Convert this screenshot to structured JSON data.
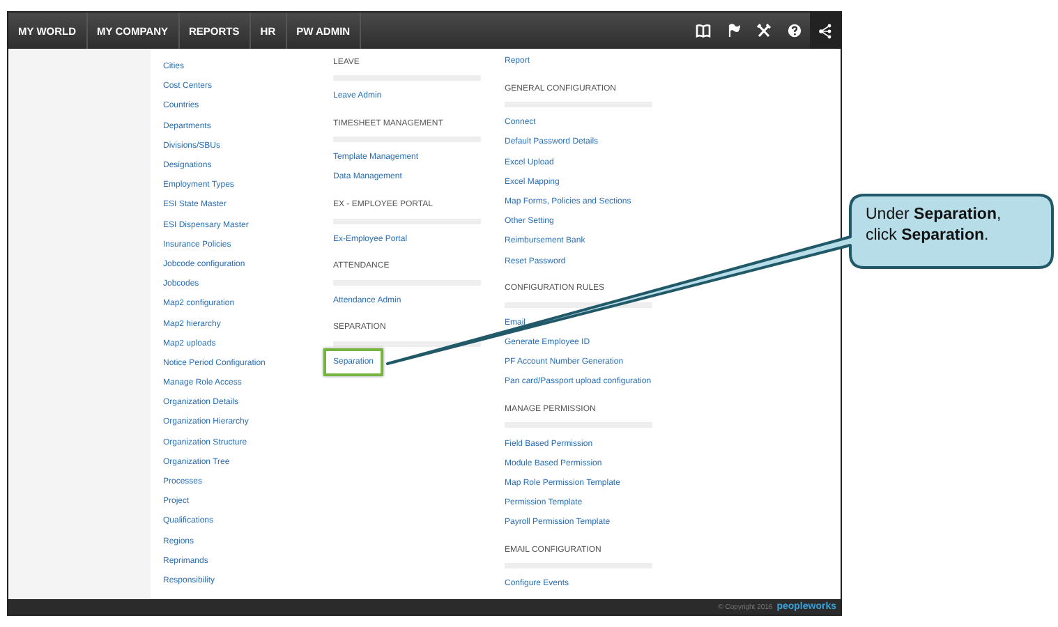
{
  "nav": {
    "items": [
      {
        "label": "MY WORLD"
      },
      {
        "label": "MY COMPANY"
      },
      {
        "label": "REPORTS"
      },
      {
        "label": "HR"
      },
      {
        "label": "PW ADMIN"
      }
    ]
  },
  "columns": [
    {
      "items": [
        {
          "kind": "link",
          "text": "Cities",
          "highlighted": false
        },
        {
          "kind": "link",
          "text": "Cost Centers",
          "highlighted": false
        },
        {
          "kind": "link",
          "text": "Countries",
          "highlighted": false
        },
        {
          "kind": "link",
          "text": "Departments",
          "highlighted": false
        },
        {
          "kind": "link",
          "text": "Divisions/SBUs",
          "highlighted": false
        },
        {
          "kind": "link",
          "text": "Designations",
          "highlighted": false
        },
        {
          "kind": "link",
          "text": "Employment Types",
          "highlighted": false
        },
        {
          "kind": "link",
          "text": "ESI State Master",
          "highlighted": false
        },
        {
          "kind": "link",
          "text": "ESI Dispensary Master",
          "highlighted": false
        },
        {
          "kind": "link",
          "text": "Insurance Policies",
          "highlighted": false
        },
        {
          "kind": "link",
          "text": "Jobcode configuration",
          "highlighted": false
        },
        {
          "kind": "link",
          "text": "Jobcodes",
          "highlighted": false
        },
        {
          "kind": "link",
          "text": "Map2 configuration",
          "highlighted": false
        },
        {
          "kind": "link",
          "text": "Map2 hierarchy",
          "highlighted": false
        },
        {
          "kind": "link",
          "text": "Map2 uploads",
          "highlighted": false
        },
        {
          "kind": "link",
          "text": "Notice Period Configuration",
          "highlighted": false
        },
        {
          "kind": "link",
          "text": "Manage Role Access",
          "highlighted": false
        },
        {
          "kind": "link",
          "text": "Organization Details",
          "highlighted": false
        },
        {
          "kind": "link",
          "text": "Organization Hierarchy",
          "highlighted": false
        },
        {
          "kind": "link",
          "text": "Organization Structure",
          "highlighted": false
        },
        {
          "kind": "link",
          "text": "Organization Tree",
          "highlighted": false
        },
        {
          "kind": "link",
          "text": "Processes",
          "highlighted": false
        },
        {
          "kind": "link",
          "text": "Project",
          "highlighted": false
        },
        {
          "kind": "link",
          "text": "Qualifications",
          "highlighted": false
        },
        {
          "kind": "link",
          "text": "Regions",
          "highlighted": false
        },
        {
          "kind": "link",
          "text": "Reprimands",
          "highlighted": false
        },
        {
          "kind": "link",
          "text": "Responsibility",
          "highlighted": false
        }
      ]
    },
    {
      "items": [
        {
          "kind": "heading",
          "text": "LEAVE"
        },
        {
          "kind": "link",
          "text": "Leave Admin",
          "highlighted": false
        },
        {
          "kind": "heading",
          "text": "TIMESHEET MANAGEMENT"
        },
        {
          "kind": "link",
          "text": "Template Management",
          "highlighted": false
        },
        {
          "kind": "link",
          "text": "Data Management",
          "highlighted": false
        },
        {
          "kind": "heading",
          "text": "EX - EMPLOYEE PORTAL"
        },
        {
          "kind": "link",
          "text": "Ex-Employee Portal",
          "highlighted": false
        },
        {
          "kind": "heading",
          "text": "ATTENDANCE"
        },
        {
          "kind": "link",
          "text": "Attendance Admin",
          "highlighted": false
        },
        {
          "kind": "heading",
          "text": "SEPARATION"
        },
        {
          "kind": "link",
          "text": "Separation",
          "highlighted": true
        }
      ]
    },
    {
      "items": [
        {
          "kind": "link",
          "text": "Report",
          "highlighted": false
        },
        {
          "kind": "heading",
          "text": "GENERAL CONFIGURATION"
        },
        {
          "kind": "link",
          "text": "Connect",
          "highlighted": false
        },
        {
          "kind": "link",
          "text": "Default Password Details",
          "highlighted": false
        },
        {
          "kind": "link",
          "text": "Excel Upload",
          "highlighted": false
        },
        {
          "kind": "link",
          "text": "Excel Mapping",
          "highlighted": false
        },
        {
          "kind": "link",
          "text": "Map Forms, Policies and Sections",
          "highlighted": false
        },
        {
          "kind": "link",
          "text": "Other Setting",
          "highlighted": false
        },
        {
          "kind": "link",
          "text": "Reimbursement Bank",
          "highlighted": false
        },
        {
          "kind": "link",
          "text": "Reset Password",
          "highlighted": false
        },
        {
          "kind": "heading",
          "text": "CONFIGURATION RULES"
        },
        {
          "kind": "link",
          "text": "Email",
          "highlighted": false
        },
        {
          "kind": "link",
          "text": "Generate Employee ID",
          "highlighted": false
        },
        {
          "kind": "link",
          "text": "PF Account Number Generation",
          "highlighted": false
        },
        {
          "kind": "link",
          "text": "Pan card/Passport upload configuration",
          "highlighted": false
        },
        {
          "kind": "heading",
          "text": "MANAGE PERMISSION"
        },
        {
          "kind": "link",
          "text": "Field Based Permission",
          "highlighted": false
        },
        {
          "kind": "link",
          "text": "Module Based Permission",
          "highlighted": false
        },
        {
          "kind": "link",
          "text": "Map Role Permission Template",
          "highlighted": false
        },
        {
          "kind": "link",
          "text": "Permission Template",
          "highlighted": false
        },
        {
          "kind": "link",
          "text": "Payroll Permission Template",
          "highlighted": false
        },
        {
          "kind": "heading",
          "text": "EMAIL CONFIGURATION"
        },
        {
          "kind": "link",
          "text": "Configure Events",
          "highlighted": false
        }
      ]
    }
  ],
  "footer": {
    "copyright": "© Copyright 2016",
    "logo": "peopleworks"
  },
  "callout": {
    "text": "Under **Separation**, click **Separation**."
  }
}
